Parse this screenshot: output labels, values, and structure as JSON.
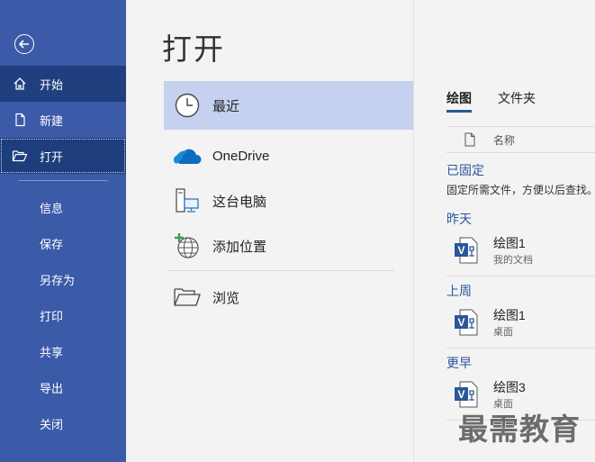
{
  "sidebar": {
    "back_icon": "back-arrow-icon",
    "items": [
      {
        "label": "开始",
        "icon": "home-icon"
      },
      {
        "label": "新建",
        "icon": "new-document-icon"
      },
      {
        "label": "打开",
        "icon": "open-folder-icon"
      }
    ],
    "sub_items": [
      "信息",
      "保存",
      "另存为",
      "打印",
      "共享",
      "导出",
      "关闭"
    ]
  },
  "page_title": "打开",
  "locations": [
    {
      "label": "最近",
      "icon": "clock-icon"
    },
    {
      "label": "OneDrive",
      "icon": "onedrive-cloud-icon"
    },
    {
      "label": "这台电脑",
      "icon": "computer-icon"
    },
    {
      "label": "添加位置",
      "icon": "add-globe-icon"
    },
    {
      "label": "浏览",
      "icon": "folder-icon"
    }
  ],
  "right_panel": {
    "tabs": [
      "绘图",
      "文件夹"
    ],
    "name_header": "名称",
    "pinned": {
      "title": "已固定",
      "hint": "固定所需文件，方便以后查找。"
    },
    "groups": [
      {
        "title": "昨天",
        "files": [
          {
            "name": "绘图1",
            "path": "我的文档"
          }
        ]
      },
      {
        "title": "上周",
        "files": [
          {
            "name": "绘图1",
            "path": "桌面"
          }
        ]
      },
      {
        "title": "更早",
        "files": [
          {
            "name": "绘图3",
            "path": "桌面"
          }
        ]
      }
    ]
  },
  "watermark": "最需教育",
  "colors": {
    "sidebar_bg": "#3b5aa8",
    "sidebar_selected": "#1f3f7f",
    "recent_highlight": "#c5d1ee",
    "accent": "#2b579a"
  }
}
